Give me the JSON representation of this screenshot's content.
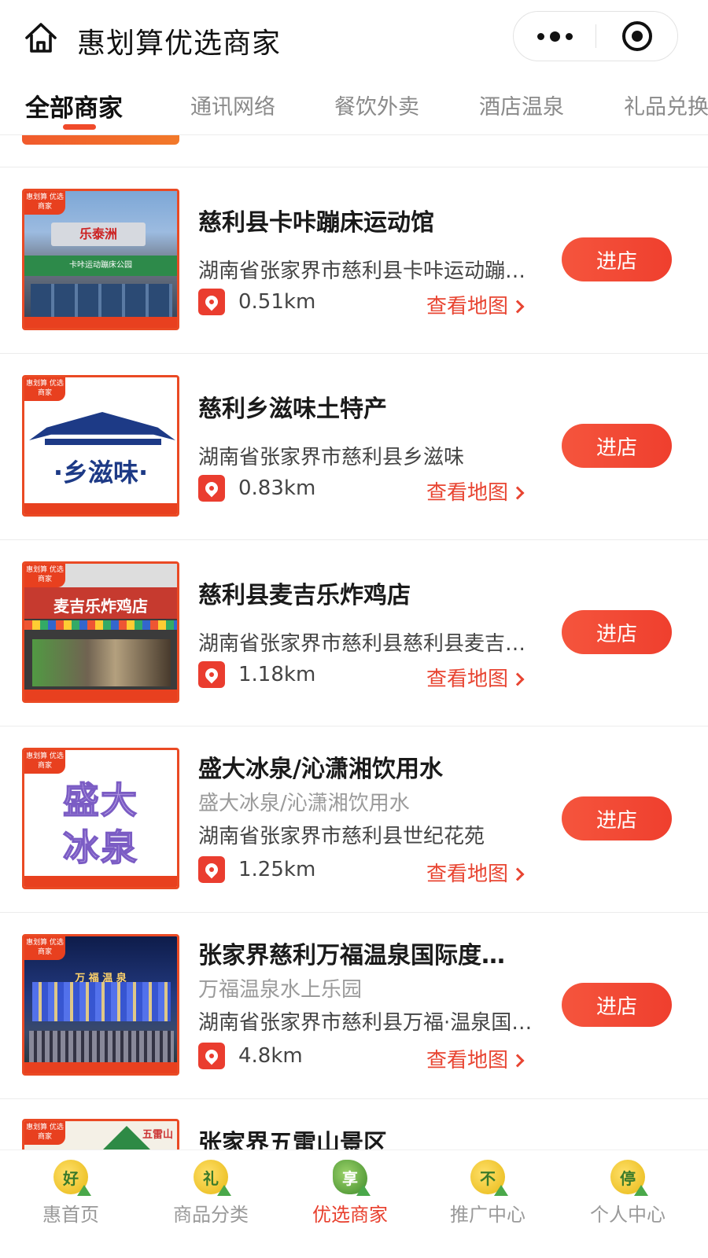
{
  "header": {
    "title": "惠划算优选商家",
    "home_icon": "home-icon",
    "more_icon": "more-dots-icon",
    "close_icon": "target-close-icon"
  },
  "tabs": [
    {
      "label": "全部商家",
      "active": true
    },
    {
      "label": "通讯网络",
      "active": false
    },
    {
      "label": "餐饮外卖",
      "active": false
    },
    {
      "label": "酒店温泉",
      "active": false
    },
    {
      "label": "礼品兑换",
      "active": false
    }
  ],
  "accent_color": "#e8402e",
  "thumb_badge": "惠划算\n优选商家",
  "map_label": "查看地图",
  "enter_label": "进店",
  "merchants": [
    {
      "name": "慈利县卡咔蹦床运动馆",
      "subname": "",
      "address": "湖南省张家界市慈利县卡咔运动蹦床公园",
      "distance": "0.51km",
      "thumb_sign": "乐泰洲",
      "thumb_band": "卡咔运动蹦床公园"
    },
    {
      "name": "慈利乡滋味土特产",
      "subname": "",
      "address": "湖南省张家界市慈利县乡滋味",
      "distance": "0.83km",
      "thumb_text": "·乡滋味·"
    },
    {
      "name": "慈利县麦吉乐炸鸡店",
      "subname": "",
      "address": "湖南省张家界市慈利县慈利县麦吉乐炸鸡店",
      "distance": "1.18km",
      "thumb_sign": "麦吉乐炸鸡店"
    },
    {
      "name": "盛大冰泉/沁潇湘饮用水",
      "subname": "盛大冰泉/沁潇湘饮用水",
      "address": "湖南省张家界市慈利县世纪花苑",
      "distance": "1.25km",
      "thumb_line1": "盛大",
      "thumb_line2": "冰泉"
    },
    {
      "name": "张家界慈利万福温泉国际度假酒店",
      "subname": "万福温泉水上乐园",
      "address": "湖南省张家界市慈利县万福·温泉国际度假酒店",
      "distance": "4.8km",
      "thumb_sign": "万 福 温 泉"
    },
    {
      "name": "张家界五雷山景区",
      "thumb_sign": "五雷山"
    }
  ],
  "bottom_nav": [
    {
      "label": "惠首页",
      "glyph": "好",
      "active": false
    },
    {
      "label": "商品分类",
      "glyph": "礼",
      "active": false
    },
    {
      "label": "优选商家",
      "glyph": "享",
      "active": true
    },
    {
      "label": "推广中心",
      "glyph": "不",
      "active": false
    },
    {
      "label": "个人中心",
      "glyph": "停",
      "active": false
    }
  ]
}
